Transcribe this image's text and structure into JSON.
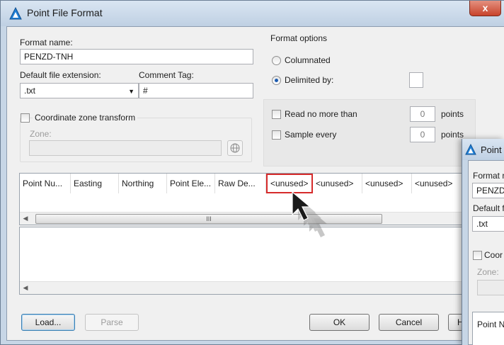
{
  "dialog": {
    "title": "Point File Format",
    "close_glyph": "x",
    "format_name_label": "Format name:",
    "format_name_value": "PENZD-TNH",
    "default_ext_label": "Default file extension:",
    "default_ext_value": ".txt",
    "comment_tag_label": "Comment Tag:",
    "comment_tag_value": "#",
    "coord_zone_label": "Coordinate zone transform",
    "zone_label": "Zone:",
    "format_options": {
      "legend": "Format options",
      "columnated_label": "Columnated",
      "delimited_label": "Delimited by:",
      "delimited_selected": true,
      "read_no_more_label": "Read no more than",
      "read_no_more_value": "0",
      "read_unit": "points",
      "sample_every_label": "Sample every",
      "sample_every_value": "0",
      "sample_unit": "points"
    },
    "columns": [
      "Point Nu...",
      "Easting",
      "Northing",
      "Point Ele...",
      "Raw De...",
      "<unused>",
      "<unused>",
      "<unused>",
      "<unused>"
    ],
    "highlighted_column_index": 5,
    "scroll_thumb_glyph": "III",
    "buttons": {
      "load": "Load...",
      "parse": "Parse",
      "ok": "OK",
      "cancel": "Cancel",
      "help_partial": "H"
    },
    "icons": {
      "app": "autocad-civil-icon",
      "zone_picker": "globe-icon",
      "pointer": "mouse-cursor-icon",
      "close": "close-icon"
    },
    "colors": {
      "highlight": "#d62b2b",
      "frame": "#c7d6e6",
      "close_button": "#c8432b"
    }
  },
  "second_dialog": {
    "title_partial": "Point",
    "format_name_partial": "Format r",
    "format_name_value_partial": "PENZD-",
    "default_ext_partial": "Default f",
    "default_ext_value": ".txt",
    "coord_partial": "Coor",
    "zone_partial": "Zone:",
    "column_partial": "Point N"
  }
}
